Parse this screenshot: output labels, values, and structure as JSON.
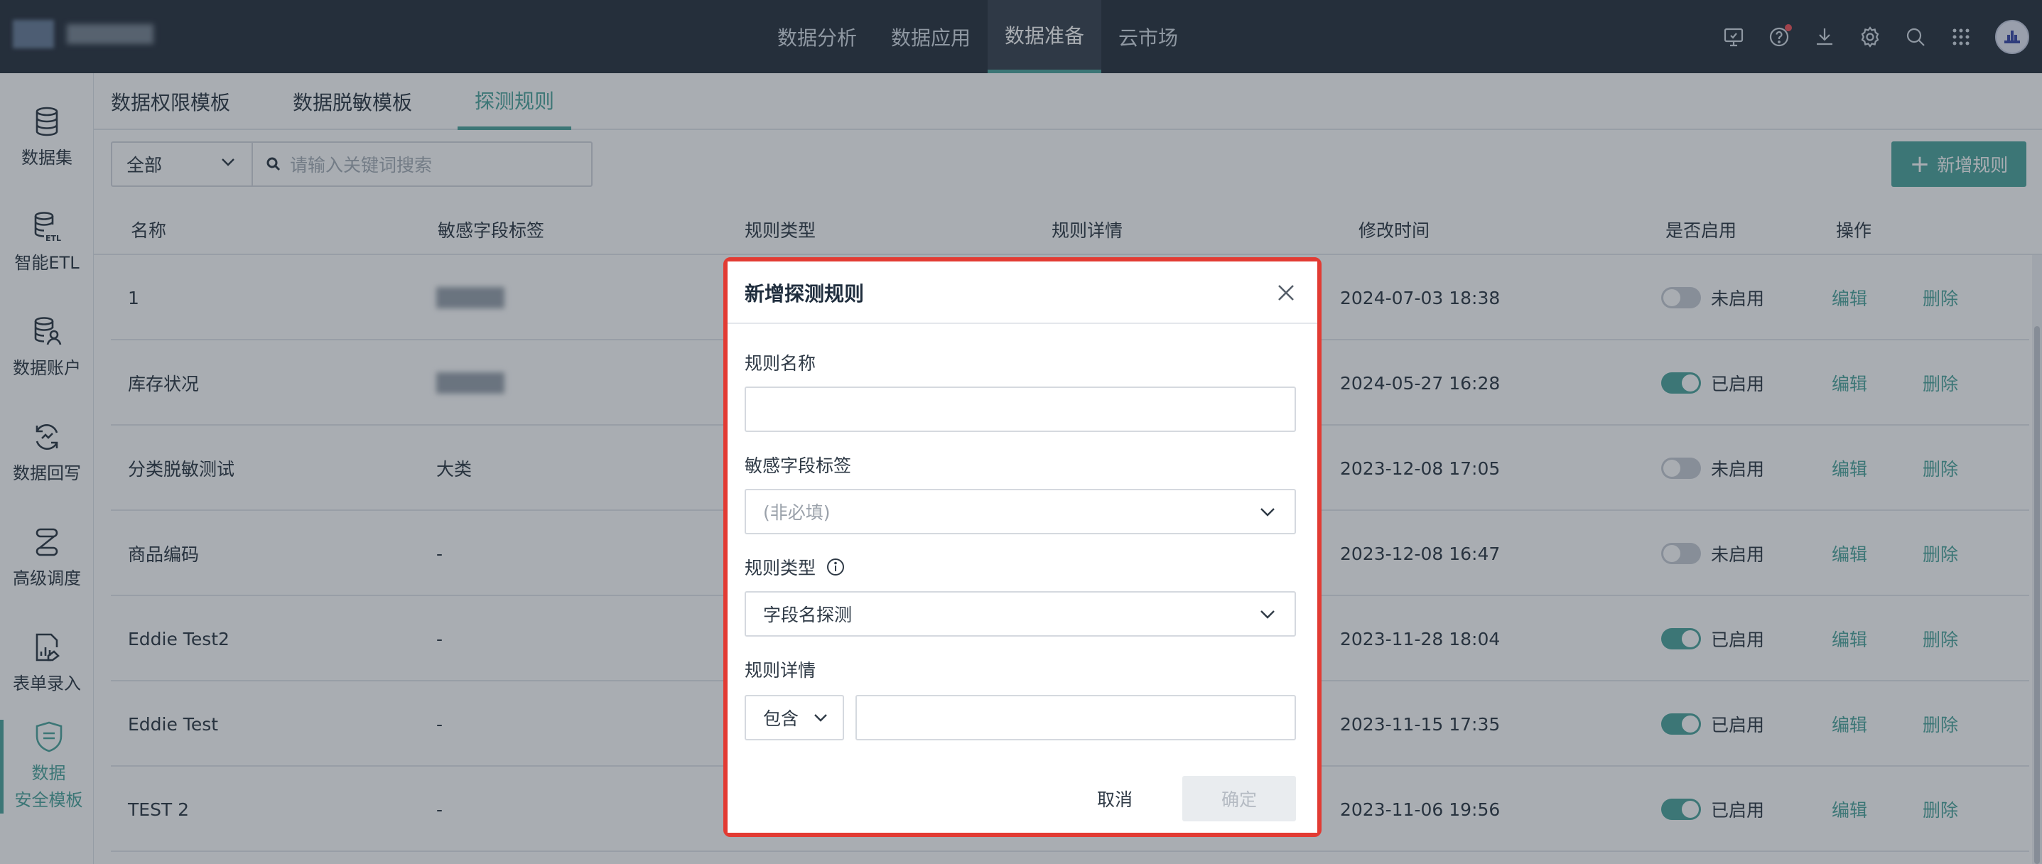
{
  "topnav": {
    "items": [
      "数据分析",
      "数据应用",
      "数据准备",
      "云市场"
    ],
    "active_index": 2
  },
  "sidebar": {
    "items": [
      {
        "label": "数据集",
        "icon": "database-icon"
      },
      {
        "label": "智能ETL",
        "icon": "etl-icon"
      },
      {
        "label": "数据账户",
        "icon": "data-account-icon"
      },
      {
        "label": "数据回写",
        "icon": "writeback-icon"
      },
      {
        "label": "高级调度",
        "icon": "schedule-icon"
      },
      {
        "label": "表单录入",
        "icon": "form-entry-icon"
      },
      {
        "label": "数据\n安全模板",
        "icon": "security-template-icon"
      }
    ]
  },
  "subtabs": [
    "数据权限模板",
    "数据脱敏模板",
    "探测规则"
  ],
  "filter": {
    "select_value": "全部",
    "search_placeholder": "请输入关键词搜索"
  },
  "add_button": "新增规则",
  "table": {
    "headers": [
      "名称",
      "敏感字段标签",
      "规则类型",
      "规则详情",
      "修改时间",
      "是否启用",
      "操作"
    ],
    "rows": [
      {
        "name": "1",
        "tag": "",
        "time": "2024-07-03 18:38",
        "enabled": false,
        "status": "未启用"
      },
      {
        "name": "库存状况",
        "tag": "",
        "time": "2024-05-27 16:28",
        "enabled": true,
        "status": "已启用"
      },
      {
        "name": "分类脱敏测试",
        "tag": "大类",
        "time": "2023-12-08 17:05",
        "enabled": false,
        "status": "未启用"
      },
      {
        "name": "商品编码",
        "tag": "-",
        "time": "2023-12-08 16:47",
        "enabled": false,
        "status": "未启用"
      },
      {
        "name": "Eddie Test2",
        "tag": "-",
        "time": "2023-11-28 18:04",
        "enabled": true,
        "status": "已启用"
      },
      {
        "name": "Eddie Test",
        "tag": "-",
        "time": "2023-11-15 17:35",
        "enabled": true,
        "status": "已启用"
      },
      {
        "name": "TEST 2",
        "tag": "-",
        "time": "2023-11-06 19:56",
        "enabled": true,
        "status": "已启用"
      }
    ],
    "edit_label": "编辑",
    "delete_label": "删除"
  },
  "modal": {
    "title": "新增探测规则",
    "rule_name_label": "规则名称",
    "rule_name_value": "",
    "tag_label": "敏感字段标签",
    "tag_placeholder": "(非必填)",
    "rule_type_label": "规则类型",
    "rule_type_value": "字段名探测",
    "rule_detail_label": "规则详情",
    "contains_value": "包含",
    "cancel": "取消",
    "confirm": "确定"
  },
  "colors": {
    "accent": "#4fa79e",
    "topbar": "#2b3440",
    "highlight_frame": "#e23b33"
  }
}
